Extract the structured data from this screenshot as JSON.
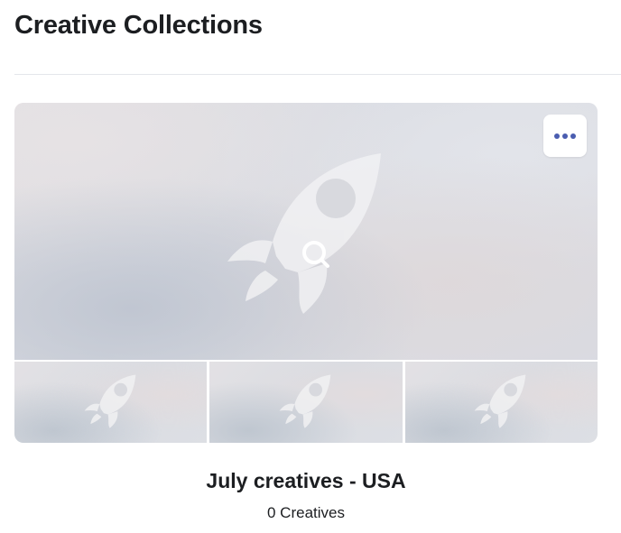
{
  "page": {
    "title": "Creative Collections"
  },
  "collection": {
    "name": "July creatives - USA",
    "count_label": "0 Creatives",
    "hero_icon": "rocket-icon",
    "overlay_icon": "search-icon",
    "thumbnail_icon": "rocket-icon",
    "more_icon": "more-horizontal-icon",
    "thumbnail_count": 3
  },
  "colors": {
    "more_dots": "#4a5db0",
    "icon_fill": "#f0f0f2",
    "title_text": "#1c1e21",
    "divider": "#e4e6eb"
  }
}
